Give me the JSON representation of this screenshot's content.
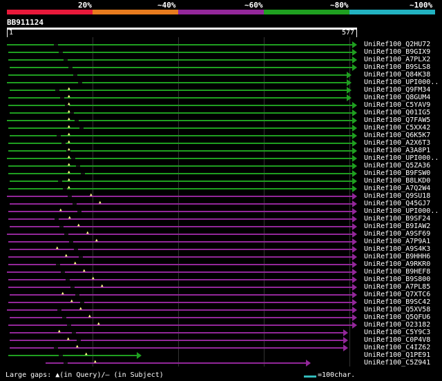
{
  "scale": {
    "labels": [
      "20%",
      "~40%",
      "~60%",
      "~80%",
      "~100%"
    ],
    "colors": [
      "#e8193a",
      "#e77b1e",
      "#93279a",
      "#1f9f20",
      "#22b2c1"
    ]
  },
  "query": {
    "id": "BB911124",
    "start": "1",
    "end": "577"
  },
  "hits": [
    {
      "name": "UniRef100_Q2HU72",
      "color": "green"
    },
    {
      "name": "UniRef100_B9GIX9",
      "color": "green"
    },
    {
      "name": "UniRef100_A7PLX2",
      "color": "green"
    },
    {
      "name": "UniRef100_B9SLS8",
      "color": "green"
    },
    {
      "name": "UniRef100_Q84K38",
      "color": "green"
    },
    {
      "name": "UniRef100_UPI000..",
      "color": "green"
    },
    {
      "name": "UniRef100_Q9FM34",
      "color": "green"
    },
    {
      "name": "UniRef100_Q8GUM4",
      "color": "green"
    },
    {
      "name": "UniRef100_C5YAV9",
      "color": "green"
    },
    {
      "name": "UniRef100_Q01IG5",
      "color": "green"
    },
    {
      "name": "UniRef100_Q7FAW5",
      "color": "green"
    },
    {
      "name": "UniRef100_C5XX42",
      "color": "green"
    },
    {
      "name": "UniRef100_Q6K5K7",
      "color": "green"
    },
    {
      "name": "UniRef100_A2X6T3",
      "color": "green"
    },
    {
      "name": "UniRef100_A3A8P1",
      "color": "green"
    },
    {
      "name": "UniRef100_UPI000..",
      "color": "green"
    },
    {
      "name": "UniRef100_Q5ZA36",
      "color": "green"
    },
    {
      "name": "UniRef100_B9FSW0",
      "color": "green"
    },
    {
      "name": "UniRef100_B8LKD0",
      "color": "green"
    },
    {
      "name": "UniRef100_A7Q2W4",
      "color": "green"
    },
    {
      "name": "UniRef100_Q9SU18",
      "color": "purple"
    },
    {
      "name": "UniRef100_Q45GJ7",
      "color": "purple"
    },
    {
      "name": "UniRef100_UPI000..",
      "color": "purple"
    },
    {
      "name": "UniRef100_B9SF24",
      "color": "purple"
    },
    {
      "name": "UniRef100_B9IAW2",
      "color": "purple"
    },
    {
      "name": "UniRef100_A9SF69",
      "color": "purple"
    },
    {
      "name": "UniRef100_A7P9A1",
      "color": "purple"
    },
    {
      "name": "UniRef100_A9S4K3",
      "color": "purple"
    },
    {
      "name": "UniRef100_B9HHH6",
      "color": "purple"
    },
    {
      "name": "UniRef100_A9RKR0",
      "color": "purple"
    },
    {
      "name": "UniRef100_B9HEF8",
      "color": "purple"
    },
    {
      "name": "UniRef100_B9S800",
      "color": "purple"
    },
    {
      "name": "UniRef100_A7PL85",
      "color": "purple"
    },
    {
      "name": "UniRef100_Q7XTC6",
      "color": "purple"
    },
    {
      "name": "UniRef100_B9SC42",
      "color": "purple"
    },
    {
      "name": "UniRef100_Q5XV58",
      "color": "purple"
    },
    {
      "name": "UniRef100_Q5QFU6",
      "color": "purple"
    },
    {
      "name": "UniRef100_O23182",
      "color": "purple"
    },
    {
      "name": "UniRef100_C5Y9C3",
      "color": "purple"
    },
    {
      "name": "UniRef100_C0P4V8",
      "color": "purple"
    },
    {
      "name": "UniRef100_C4IZ62",
      "color": "purple"
    },
    {
      "name": "UniRef100_Q1PE91",
      "color": "green"
    },
    {
      "name": "UniRef100_C5Z941",
      "color": "purple"
    }
  ],
  "legend": {
    "left": "Large gaps: ▲(in Query)/– (in Subject)",
    "right": "=100char."
  }
}
